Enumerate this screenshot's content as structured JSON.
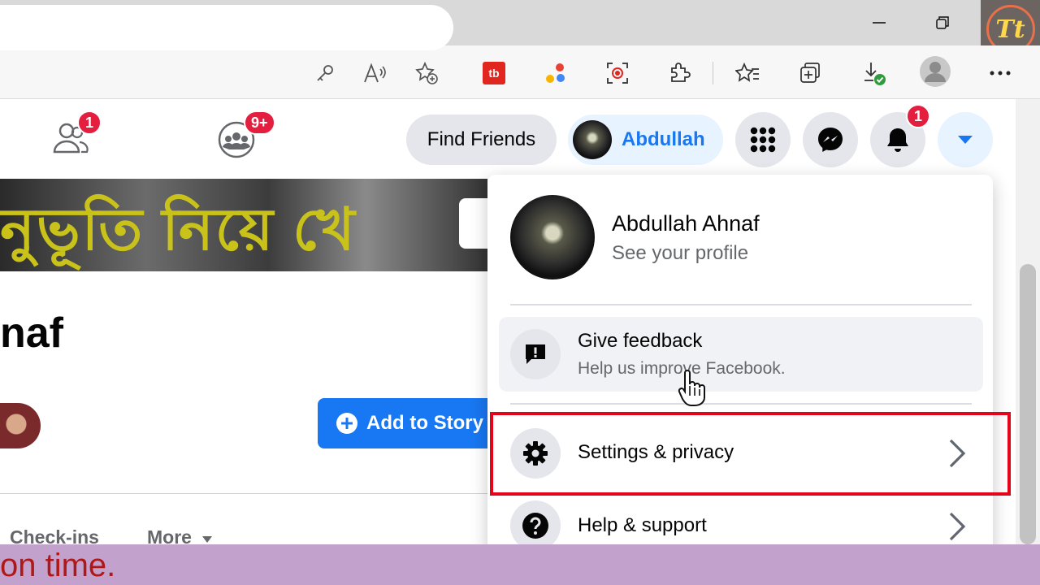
{
  "browser": {
    "window_controls": [
      "minimize",
      "restore"
    ],
    "logo_text": "Tt",
    "toolbar_icons": [
      "key-icon",
      "read-aloud-icon",
      "add-favorite-icon",
      "fb-extension-icon",
      "color-dots-extension-icon",
      "screen-capture-icon",
      "extensions-icon",
      "favorites-icon",
      "collections-icon",
      "downloads-icon",
      "profile-icon",
      "more-icon"
    ],
    "extension_label": "tb"
  },
  "fb_header": {
    "friends_badge": "1",
    "groups_badge": "9+",
    "find_friends_label": "Find Friends",
    "profile_pill_label": "Abdullah",
    "notifications_badge": "1",
    "accent_color": "#1877f2"
  },
  "profile": {
    "cover_text": "নুভূতি নিয়ে খে",
    "name_partial": "naf",
    "add_story_label": "Add to Story",
    "tabs": [
      "Check-ins",
      "More"
    ]
  },
  "dropdown": {
    "user_name": "Abdullah Ahnaf",
    "user_sub": "See your profile",
    "items": [
      {
        "title": "Give feedback",
        "desc": "Help us improve Facebook."
      },
      {
        "title": "Settings & privacy",
        "desc": ""
      },
      {
        "title": "Help & support",
        "desc": ""
      }
    ]
  },
  "caption": {
    "text": "on time."
  }
}
